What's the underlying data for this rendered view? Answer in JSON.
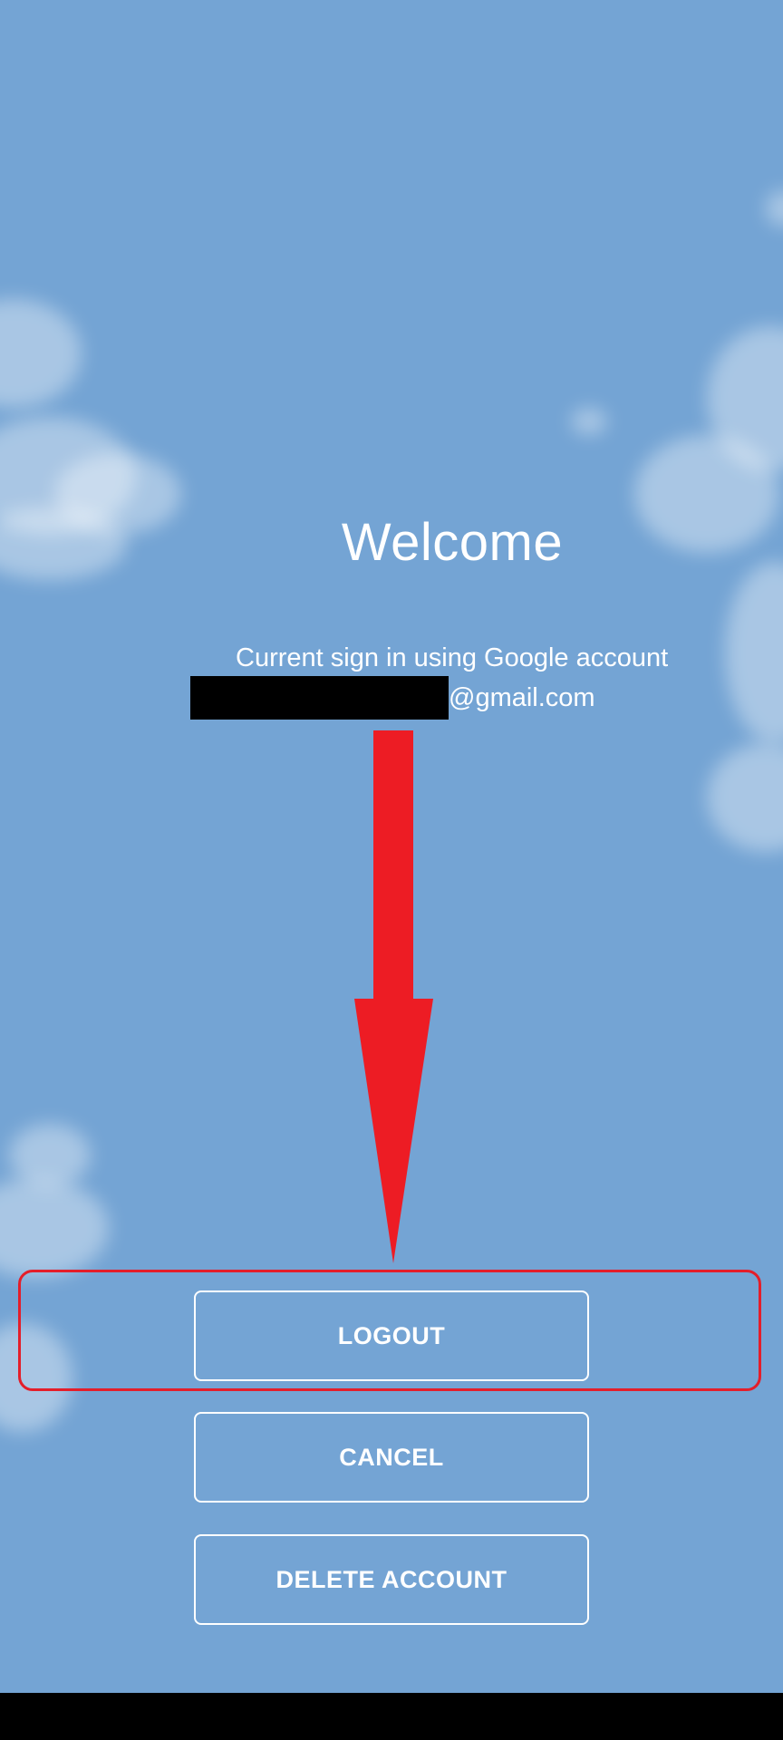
{
  "screen": {
    "title": "Welcome",
    "account_line": "Current sign in using Google account",
    "email_suffix": "@gmail.com"
  },
  "buttons": {
    "logout": "LOGOUT",
    "cancel": "CANCEL",
    "delete_account": "DELETE ACCOUNT"
  },
  "annotation": {
    "arrow_color": "#ed1c24",
    "highlight_color": "#e41e2a"
  },
  "colors": {
    "background": "#74a4d4",
    "text": "#ffffff",
    "navbar": "#000000"
  }
}
